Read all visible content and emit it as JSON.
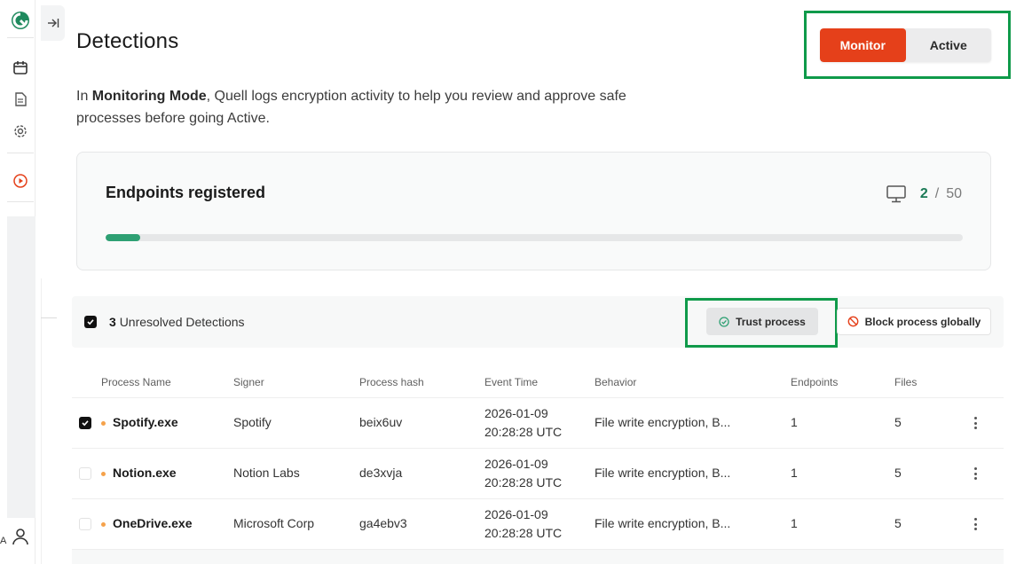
{
  "header": {
    "title": "Detections",
    "mode_toggle": {
      "monitor_label": "Monitor",
      "active_label": "Active",
      "selected": "Monitor"
    }
  },
  "intro": {
    "prefix": "In ",
    "bold": "Monitoring Mode",
    "rest": ", Quell logs encryption activity to help you review and approve safe processes before going Active."
  },
  "endpoints": {
    "title": "Endpoints registered",
    "registered": "2",
    "separator": "/",
    "limit": "50",
    "progress_fraction": 0.04
  },
  "toolbar": {
    "count": "3",
    "label": "Unresolved Detections",
    "trust_label": "Trust process",
    "block_label": "Block process globally"
  },
  "table": {
    "columns": [
      "Process Name",
      "Signer",
      "Process hash",
      "Event Time",
      "Behavior",
      "Endpoints",
      "Files"
    ],
    "rows": [
      {
        "checked": true,
        "name": "Spotify.exe",
        "signer": "Spotify",
        "hash": "beix6uv",
        "date": "2026-01-09",
        "time": "20:28:28 UTC",
        "behavior": "File write encryption, B...",
        "endpoints": "1",
        "files": "5"
      },
      {
        "checked": false,
        "name": "Notion.exe",
        "signer": "Notion Labs",
        "hash": "de3xvja",
        "date": "2026-01-09",
        "time": "20:28:28 UTC",
        "behavior": "File write encryption, B...",
        "endpoints": "1",
        "files": "5"
      },
      {
        "checked": false,
        "name": "OneDrive.exe",
        "signer": "Microsoft Corp",
        "hash": "ga4ebv3",
        "date": "2026-01-09",
        "time": "20:28:28 UTC",
        "behavior": "File write encryption, B...",
        "endpoints": "1",
        "files": "5"
      }
    ]
  },
  "sidebar": {
    "icons": [
      "logo-icon",
      "calendar-icon",
      "document-icon",
      "settings-icon",
      "play-circle-icon",
      "user-icon"
    ],
    "bottom_letter": "A"
  },
  "colors": {
    "accent_orange": "#e5401a",
    "brand_green": "#1a7a56",
    "progress_green": "#2ea073",
    "highlight_green": "#0f9a4a"
  }
}
